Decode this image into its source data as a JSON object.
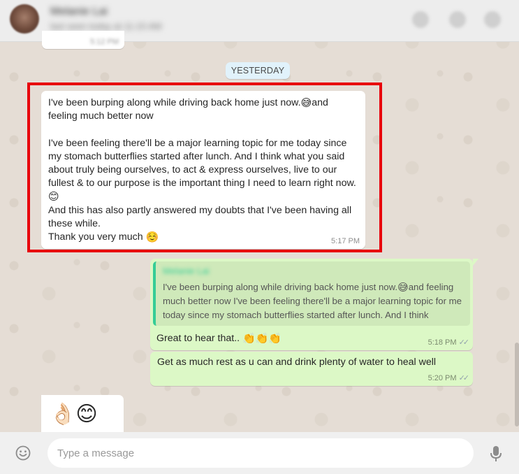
{
  "header": {
    "contact_name": "Melanie Lai",
    "contact_status": "last seen today at 11:15 AM"
  },
  "previous_message": {
    "time": "5:12 PM"
  },
  "date_divider": "YESTERDAY",
  "incoming_message": {
    "line1": "I've been burping along while driving back home just now.",
    "emoji1": "😅",
    "line1b": "and",
    "line2": "feeling much better now",
    "para2": "I've been feeling there'll be a major learning topic for me today since my stomach butterflies started after lunch. And I think what you said about truly being ourselves, to act & express ourselves, live to our fullest & to our purpose is the important thing I need to learn right now.",
    "emoji2": "😊",
    "para3": "And this has also partly answered my doubts that I've been having all these while.",
    "thanks": "Thank you very much",
    "emoji3": "☺️",
    "time": "5:17 PM"
  },
  "reply_message": {
    "quoted_author": "Melanie Lai",
    "quoted_text_a": "I've been burping along while driving back home just now.",
    "quoted_emoji": "😅",
    "quoted_text_b": "and feeling much better now I've been feeling there'll be a major learning topic for me today since my stomach butterflies started after lunch. And I think",
    "text": "Great to hear that..",
    "emoji": "👏👏👏",
    "time": "5:18 PM",
    "status": "✓✓"
  },
  "followup_message": {
    "text": "Get as much rest as u can and drink plenty of water to heal well",
    "time": "5:20 PM",
    "status": "✓✓"
  },
  "emoji_message": {
    "content": "👌🏻😊"
  },
  "composer": {
    "placeholder": "Type a message"
  },
  "colors": {
    "background": "#e5ddd5",
    "incoming_bubble": "#ffffff",
    "outgoing_bubble": "#dcf8c6",
    "highlight": "#e8000b",
    "quote_bar": "#35cd96"
  },
  "icons": {
    "emoji_button": "smiley-icon",
    "voice_button": "mic-icon"
  }
}
